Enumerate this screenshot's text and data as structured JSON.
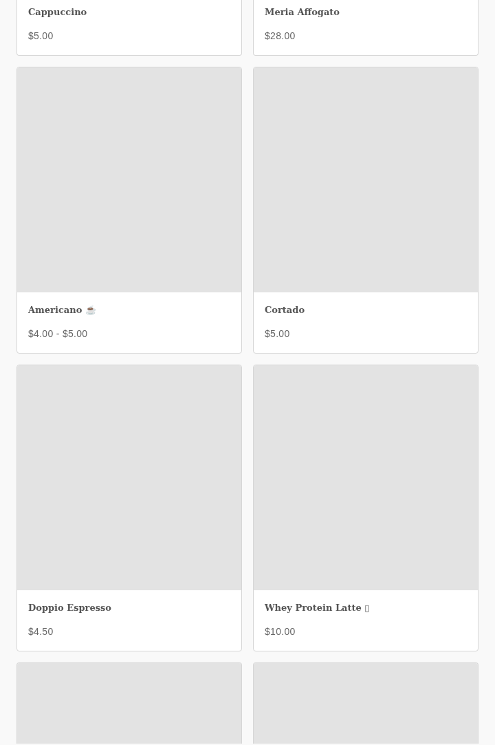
{
  "products": [
    {
      "kind": "scrolled",
      "name": "Cappuccino",
      "price": "$5.00"
    },
    {
      "kind": "scrolled",
      "name": "Meria Affogato",
      "price": "$28.00"
    },
    {
      "kind": "full",
      "name": "Americano ☕",
      "price": "$4.00 - $5.00"
    },
    {
      "kind": "full",
      "name": "Cortado",
      "price": "$5.00"
    },
    {
      "kind": "full",
      "name": "Doppio Espresso",
      "price": "$4.50"
    },
    {
      "kind": "full",
      "name": "Whey Protein Latte ▯",
      "price": "$10.00"
    },
    {
      "kind": "cut"
    },
    {
      "kind": "cut"
    }
  ]
}
